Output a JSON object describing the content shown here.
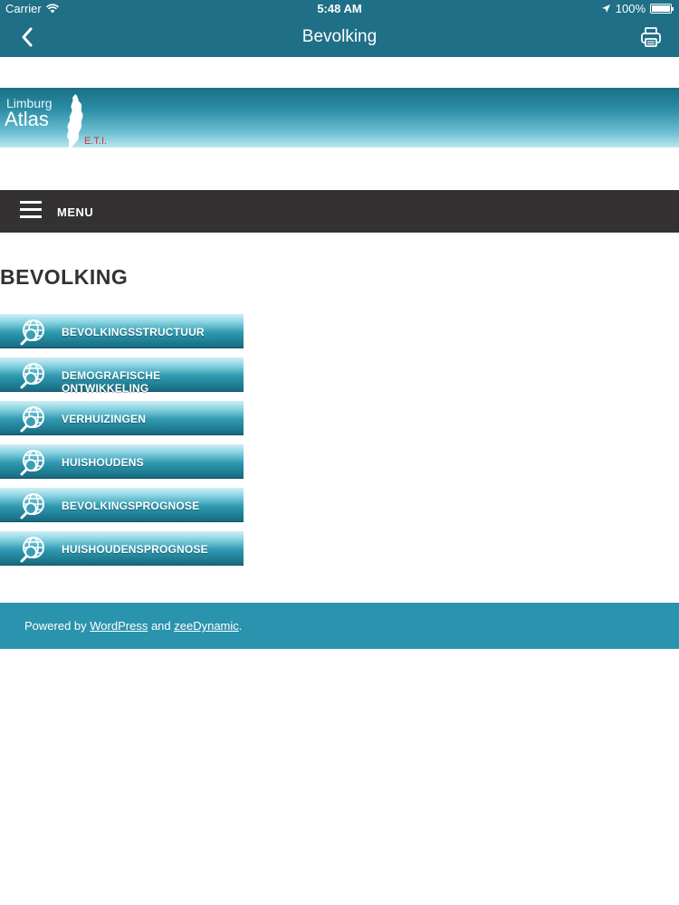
{
  "status_bar": {
    "carrier": "Carrier",
    "time": "5:48 AM",
    "battery": "100%",
    "battery_level": 1.0
  },
  "nav": {
    "title": "Bevolking",
    "back_icon": "chevron-left-icon",
    "print_icon": "printer-icon"
  },
  "banner": {
    "logo_line1": "Limburg",
    "logo_line2": "Atlas",
    "logo_line3": "E.T.I."
  },
  "menu": {
    "label": "MENU"
  },
  "page": {
    "title": "BEVOLKING"
  },
  "categories": [
    {
      "label": "BEVOLKINGSSTRUCTUUR",
      "icon": "globe-search-icon"
    },
    {
      "label": "DEMOGRAFISCHE ONTWIKKELING",
      "icon": "globe-search-icon"
    },
    {
      "label": "VERHUIZINGEN",
      "icon": "globe-search-icon"
    },
    {
      "label": "HUISHOUDENS",
      "icon": "globe-search-icon"
    },
    {
      "label": "BEVOLKINGSPROGNOSE",
      "icon": "globe-search-icon"
    },
    {
      "label": "HUISHOUDENSPROGNOSE",
      "icon": "globe-search-icon"
    }
  ],
  "footer": {
    "prefix": "Powered by ",
    "link1": "WordPress",
    "middle": " and ",
    "link2": "zeeDynamic",
    "suffix": "."
  },
  "colors": {
    "header": "#1f6f86",
    "menubar": "#333132",
    "footer": "#2a93ae",
    "title_text": "#333132"
  }
}
